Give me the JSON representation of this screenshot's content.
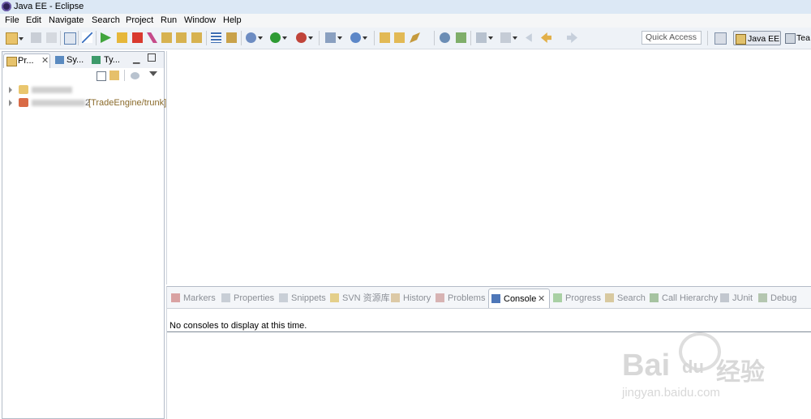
{
  "window": {
    "title": "Java EE - Eclipse"
  },
  "menu": [
    "File",
    "Edit",
    "Navigate",
    "Search",
    "Project",
    "Run",
    "Window",
    "Help"
  ],
  "toolbar": {
    "quick_access_placeholder": "Quick Access",
    "perspectives": [
      "Java EE",
      "Tea"
    ]
  },
  "left_pane": {
    "tabs": [
      {
        "label": "Pr...",
        "active": true,
        "closable": true
      },
      {
        "label": "Sy...",
        "active": false
      },
      {
        "label": "Ty...",
        "active": false
      }
    ],
    "tree": [
      {
        "label": "",
        "suffix": ""
      },
      {
        "label": "2",
        "suffix": "[TradeEngine/trunk]"
      }
    ]
  },
  "bottom_pane": {
    "tabs": [
      {
        "label": "Markers",
        "icon": "markers-icon"
      },
      {
        "label": "Properties",
        "icon": "properties-icon"
      },
      {
        "label": "Snippets",
        "icon": "snippets-icon"
      },
      {
        "label": "SVN 资源库",
        "icon": "svn-repo-icon"
      },
      {
        "label": "History",
        "icon": "history-icon"
      },
      {
        "label": "Problems",
        "icon": "problems-icon"
      },
      {
        "label": "Console",
        "icon": "console-icon",
        "active": true
      },
      {
        "label": "Progress",
        "icon": "progress-icon"
      },
      {
        "label": "Search",
        "icon": "search-icon"
      },
      {
        "label": "Call Hierarchy",
        "icon": "call-hierarchy-icon"
      },
      {
        "label": "JUnit",
        "icon": "junit-icon"
      },
      {
        "label": "Debug",
        "icon": "debug-icon"
      }
    ],
    "console_message": "No consoles to display at this time."
  },
  "watermark": {
    "brand": "Bai",
    "brand2": "du",
    "cn": "经验",
    "url": "jingyan.baidu.com"
  }
}
